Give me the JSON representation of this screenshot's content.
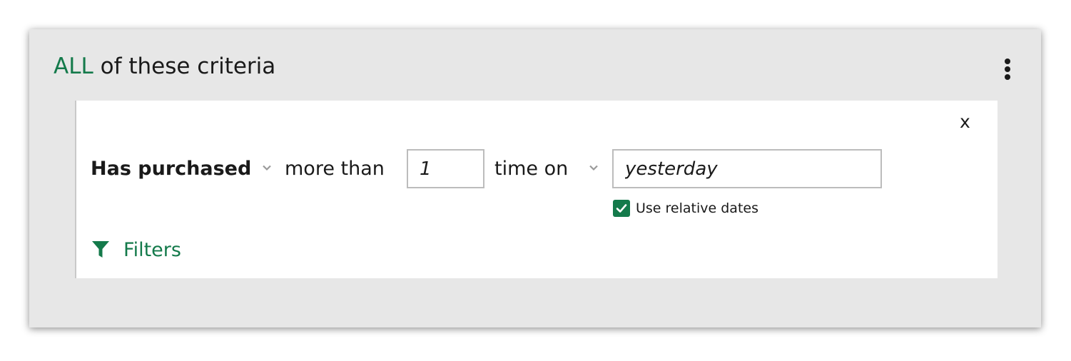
{
  "criteria": {
    "quantifier": "ALL",
    "heading_rest": "of these criteria"
  },
  "menu": {
    "icon": "kebab-menu-icon"
  },
  "rule": {
    "close_label": "x",
    "event": "Has purchased",
    "comparator": "more than",
    "count_value": "1",
    "unit_label": "time on",
    "date_value": "yesterday",
    "relative_dates_label": "Use relative dates",
    "relative_dates_checked": true
  },
  "filters": {
    "label": "Filters",
    "icon": "funnel-icon"
  },
  "colors": {
    "accent": "#147a4b",
    "panel_bg": "#e7e7e7",
    "card_bg": "#ffffff"
  }
}
